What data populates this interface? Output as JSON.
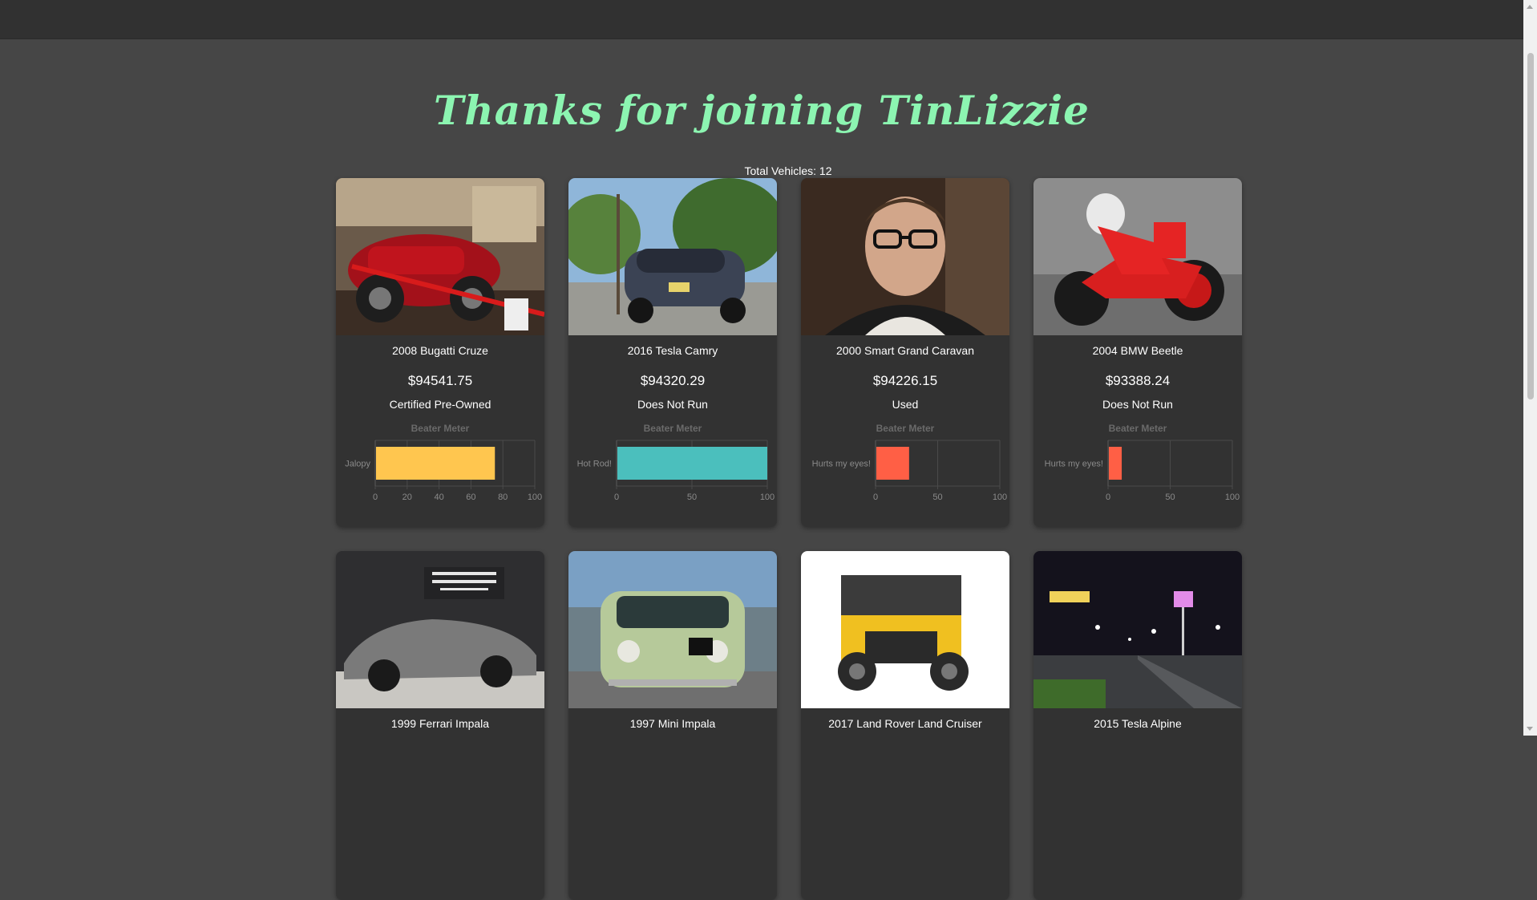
{
  "page": {
    "title": "Thanks for joining TinLizzie",
    "total_label": "Total Vehicles: 12"
  },
  "meter_title": "Beater Meter",
  "cards": [
    {
      "name": "2008 Bugatti Cruze",
      "price": "$94541.75",
      "condition": "Certified Pre-Owned",
      "image": "red-vintage-roadster-photo",
      "chart_data": {
        "type": "bar",
        "title": "Beater Meter",
        "categories": [
          "Jalopy"
        ],
        "values": [
          75
        ],
        "xlim": [
          0,
          100
        ],
        "ticks": [
          0,
          20,
          40,
          60,
          80,
          100
        ],
        "color": "#ffc64f"
      }
    },
    {
      "name": "2016 Tesla Camry",
      "price": "$94320.29",
      "condition": "Does Not Run",
      "image": "gray-tesla-rear-photo",
      "chart_data": {
        "type": "bar",
        "title": "Beater Meter",
        "categories": [
          "Hot Rod!"
        ],
        "values": [
          100
        ],
        "xlim": [
          0,
          100
        ],
        "ticks": [
          0,
          50,
          100
        ],
        "color": "#4bbfbd"
      }
    },
    {
      "name": "2000 Smart Grand Caravan",
      "price": "$94226.15",
      "condition": "Used",
      "image": "man-with-glasses-photo",
      "chart_data": {
        "type": "bar",
        "title": "Beater Meter",
        "categories": [
          "Hurts my eyes!"
        ],
        "values": [
          27
        ],
        "xlim": [
          0,
          100
        ],
        "ticks": [
          0,
          50,
          100
        ],
        "color": "#ff5f45"
      }
    },
    {
      "name": "2004 BMW Beetle",
      "price": "$93388.24",
      "condition": "Does Not Run",
      "image": "red-motorcycle-racer-photo",
      "chart_data": {
        "type": "bar",
        "title": "Beater Meter",
        "categories": [
          "Hurts my eyes!"
        ],
        "values": [
          11
        ],
        "xlim": [
          0,
          100
        ],
        "ticks": [
          0,
          50,
          100
        ],
        "color": "#ff5f45"
      }
    },
    {
      "name": "1999 Ferrari Impala",
      "image": "gray-ferrari-showroom-photo"
    },
    {
      "name": "1997 Mini Impala",
      "image": "green-mini-cooper-photo"
    },
    {
      "name": "2017 Land Rover Land Cruiser",
      "image": "yellow-lego-defender-photo"
    },
    {
      "name": "2015 Tesla Alpine",
      "image": "night-street-lights-photo"
    }
  ],
  "colors": {
    "background": "#464646",
    "card": "#323232",
    "title": "#8cf5b1",
    "topbar": "#313131"
  }
}
